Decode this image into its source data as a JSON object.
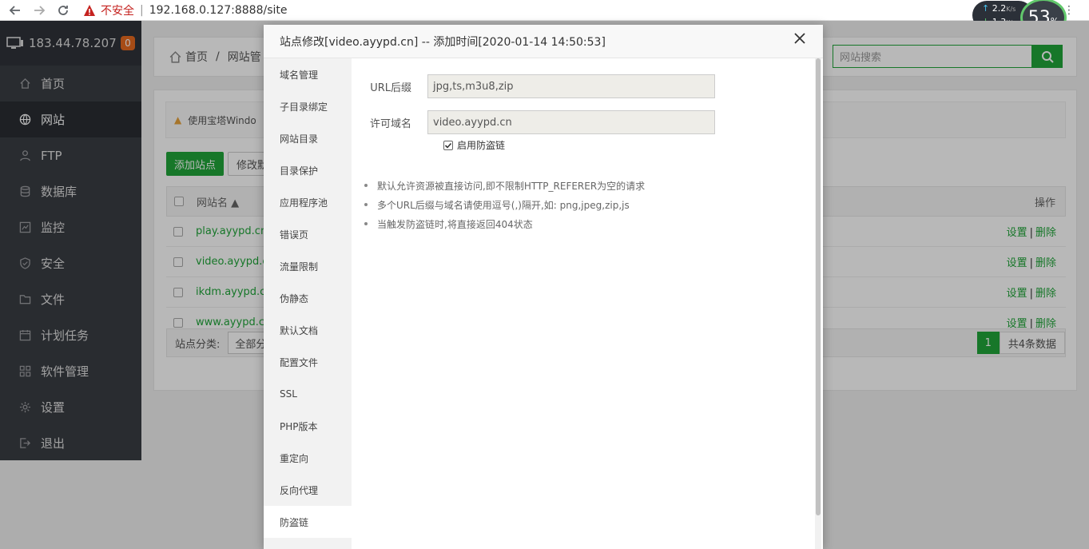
{
  "browser": {
    "insecure_label": "不安全",
    "url": "192.168.0.127:8888/site",
    "speed_up": "2.2",
    "speed_down": "1.3",
    "speed_unit": "K/s",
    "cpu_percent": "53",
    "percent_sign": "%"
  },
  "sidebar": {
    "ip": "183.44.78.207",
    "badge": "0",
    "items": [
      {
        "label": "首页",
        "icon": "home-icon"
      },
      {
        "label": "网站",
        "icon": "globe-icon"
      },
      {
        "label": "FTP",
        "icon": "user-icon"
      },
      {
        "label": "数据库",
        "icon": "database-icon"
      },
      {
        "label": "监控",
        "icon": "monitor-icon"
      },
      {
        "label": "安全",
        "icon": "shield-icon"
      },
      {
        "label": "文件",
        "icon": "folder-icon"
      },
      {
        "label": "计划任务",
        "icon": "calendar-icon"
      },
      {
        "label": "软件管理",
        "icon": "grid-icon"
      },
      {
        "label": "设置",
        "icon": "gear-icon"
      },
      {
        "label": "退出",
        "icon": "logout-icon"
      }
    ],
    "add": "+"
  },
  "main": {
    "breadcrumb_home": "首页",
    "breadcrumb_sep": "/",
    "breadcrumb_current": "网站管",
    "search_placeholder": "网站搜索",
    "notice": "使用宝塔Windo",
    "add_site": "添加站点",
    "modify_default": "修改默",
    "col_site": "网站名 ▲",
    "col_ops": "操作",
    "rows": [
      {
        "site": "play.ayypd.cn"
      },
      {
        "site": "video.ayypd.cn"
      },
      {
        "site": "ikdm.ayypd.cn"
      },
      {
        "site": "www.ayypd.cn"
      }
    ],
    "op_set": "设置",
    "op_sep": "|",
    "op_del": "删除",
    "category_label": "站点分类:",
    "category_value": "全部分",
    "page": "1",
    "total": "共4条数据"
  },
  "modal": {
    "title": "站点修改[video.ayypd.cn] -- 添加时间[2020-01-14 14:50:53]",
    "tabs": [
      "域名管理",
      "子目录绑定",
      "网站目录",
      "目录保护",
      "应用程序池",
      "错误页",
      "流量限制",
      "伪静态",
      "默认文档",
      "配置文件",
      "SSL",
      "PHP版本",
      "重定向",
      "反向代理",
      "防盗链"
    ],
    "active_tab": 14,
    "url_suffix_label": "URL后缀",
    "url_suffix_value": "jpg,ts,m3u8,zip",
    "domain_label": "许可域名",
    "domain_value": "video.ayypd.cn",
    "enable_label": "启用防盗链",
    "enable_checked": true,
    "tips": [
      "默认允许资源被直接访问,即不限制HTTP_REFERER为空的请求",
      "多个URL后缀与域名请使用逗号(,)隔开,如: png,jpeg,zip,js",
      "当触发防盗链时,将直接返回404状态"
    ]
  }
}
